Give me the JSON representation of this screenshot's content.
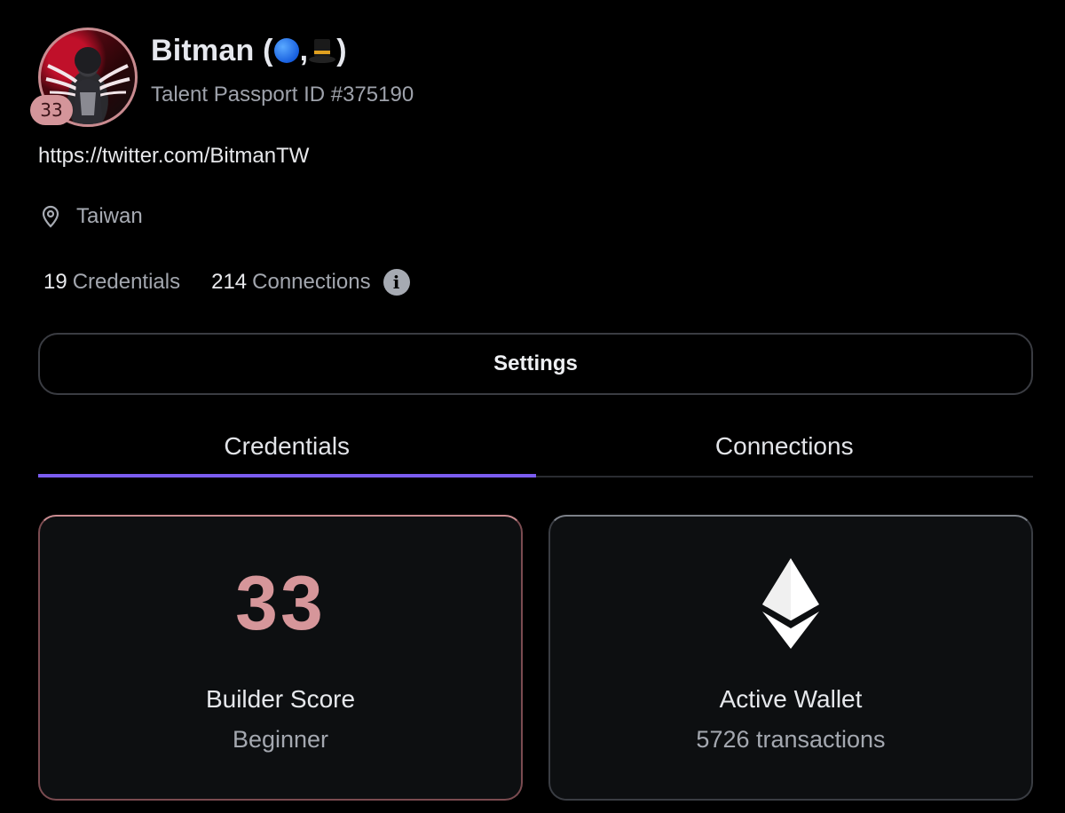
{
  "profile": {
    "name": "Bitman (",
    "name_sep": ",",
    "name_end": ")",
    "score_badge": "33",
    "passport_id": "Talent Passport ID #375190",
    "link": "https://twitter.com/BitmanTW",
    "location": "Taiwan"
  },
  "stats": {
    "credentials_count": "19",
    "credentials_label": "Credentials",
    "connections_count": "214",
    "connections_label": "Connections",
    "info_glyph": "i"
  },
  "settings_label": "Settings",
  "tabs": [
    {
      "label": "Credentials",
      "active": true
    },
    {
      "label": "Connections",
      "active": false
    }
  ],
  "cards": {
    "builder": {
      "value": "33",
      "title": "Builder Score",
      "subtitle": "Beginner"
    },
    "wallet": {
      "icon": "ethereum-icon",
      "title": "Active Wallet",
      "subtitle": "5726 transactions"
    }
  },
  "colors": {
    "accent": "#7b5cf0",
    "score": "#d6969a",
    "background": "#000000",
    "card": "#0d0f11"
  }
}
